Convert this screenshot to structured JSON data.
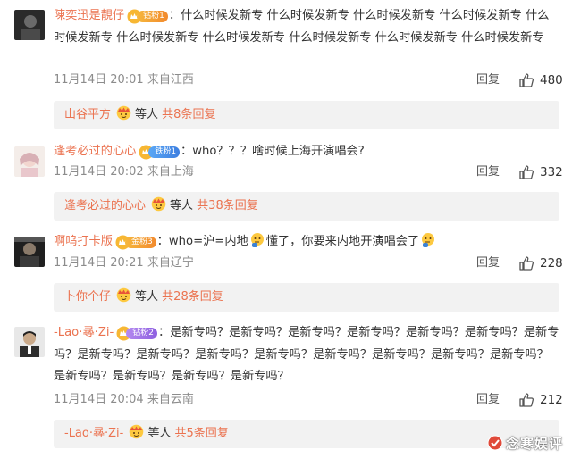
{
  "comments": [
    {
      "username": "陳奕迅是靚仔",
      "badge": "钻粉1",
      "text": "什么时候发新专 什么时候发新专 什么时候发新专 什么时候发新专 什么时候发新专 什么时候发新专 什么时候发新专 什么时候发新专 什么时候发新专 什么时候发新专",
      "time": "11月14日 20:01",
      "location": "来自江西",
      "reply_label": "回复",
      "likes": "480",
      "reply_preview": {
        "name": "山谷平方",
        "middle": "等人",
        "count": "共8条回复"
      }
    },
    {
      "username": "逢考必过的心心",
      "badge": "铁粉1",
      "text": "who？？？啥时候上海开演唱会?",
      "time": "11月14日 20:02",
      "location": "来自上海",
      "reply_label": "回复",
      "likes": "332",
      "reply_preview": {
        "name": "逢考必过的心心",
        "middle": "等人",
        "count": "共38条回复"
      }
    },
    {
      "username": "啊呜打卡版",
      "badge": "金粉3",
      "text_a": "who=沪=内地",
      "text_b": "懂了，你要来内地开演唱会了",
      "time": "11月14日 20:21",
      "location": "来自辽宁",
      "reply_label": "回复",
      "likes": "228",
      "reply_preview": {
        "name": "卜你个仔",
        "middle": "等人",
        "count": "共28条回复"
      }
    },
    {
      "username": "-Lao·㝷·Zi-",
      "badge": "钻粉2",
      "text": "是新专吗？是新专吗？是新专吗？是新专吗？是新专吗？是新专吗？是新专吗？是新专吗？是新专吗？是新专吗？是新专吗？是新专吗？是新专吗？是新专吗？是新专吗？是新专吗？是新专吗？是新专吗？是新专吗？",
      "time": "11月14日 20:04",
      "location": "来自云南",
      "reply_label": "回复",
      "likes": "212",
      "reply_preview": {
        "name": "-Lao·㝷·Zi-",
        "middle": "等人",
        "count": "共5条回复"
      }
    }
  ],
  "watermark": "念寒娱评",
  "colors": {
    "username": "#eb7350",
    "meta": "#8c8c8c",
    "reply_bg": "#f2f2f2"
  },
  "icons": [
    "thumbs-up-icon",
    "fan-crown-icon",
    "emoji-smile-icon"
  ]
}
